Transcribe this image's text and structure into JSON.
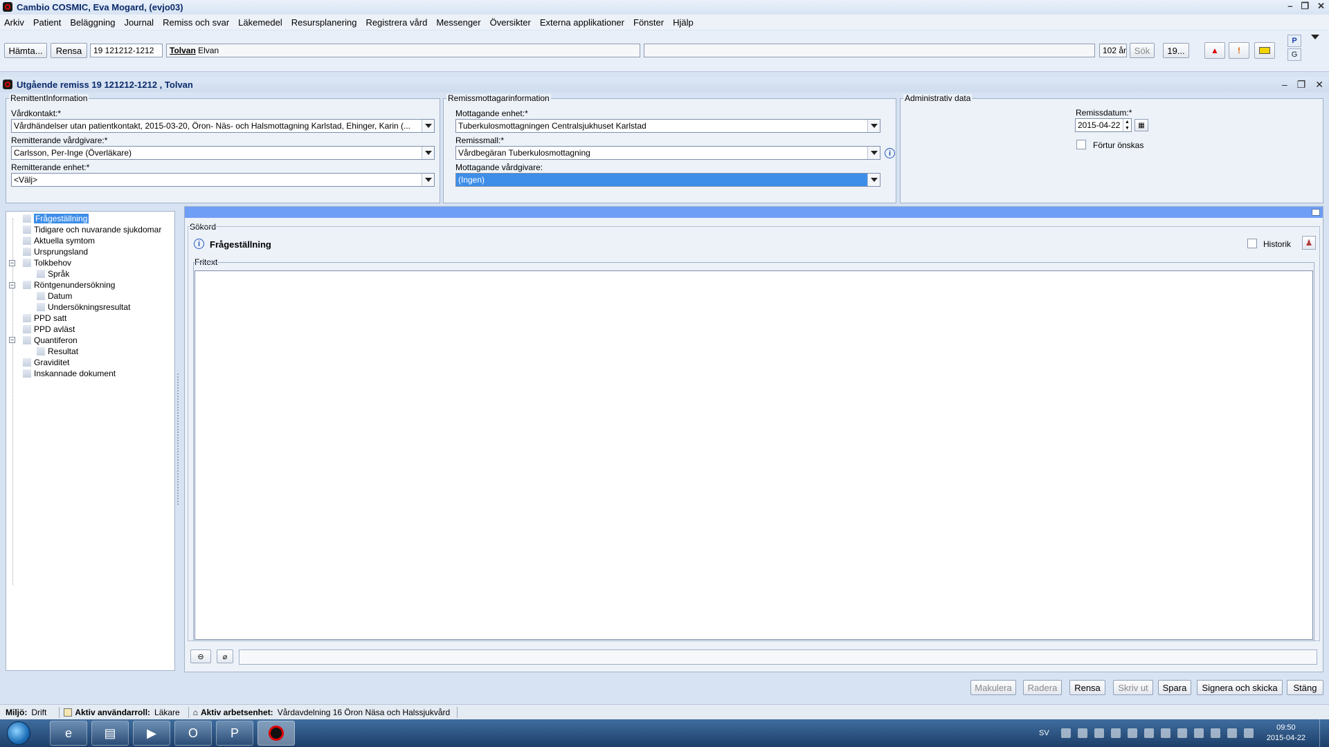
{
  "window": {
    "title": "Cambio COSMIC, Eva Mogard, (evjo03)"
  },
  "menu": [
    "Arkiv",
    "Patient",
    "Beläggning",
    "Journal",
    "Remiss och svar",
    "Läkemedel",
    "Resursplanering",
    "Registrera vård",
    "Messenger",
    "Översikter",
    "Externa applikationer",
    "Fönster",
    "Hjälp"
  ],
  "toolbar": {
    "fetch_label": "Hämta...",
    "clear_label": "Rensa",
    "personnummer": "19 121212-1212",
    "patient_lastname": "Tolvan",
    "patient_firstname": "Elvan",
    "age": "102 år",
    "search_label": "Sök",
    "year_label": "19...",
    "p_label": "P",
    "g_label": "G"
  },
  "document": {
    "title": "Utgående remiss 19 121212-1212 , Tolvan"
  },
  "remittent": {
    "title": "RemittentInformation",
    "vardkontakt_label": "Vårdkontakt:*",
    "vardkontakt_value": "Vårdhändelser utan patientkontakt, 2015-03-20, Öron- Näs- och Halsmottagning Karlstad, Ehinger, Karin (...",
    "vardgivare_label": "Remitterande vårdgivare:*",
    "vardgivare_value": "Carlsson, Per-Inge (Överläkare)",
    "enhet_label": "Remitterande enhet:*",
    "enhet_value": "<Välj>"
  },
  "mottagare": {
    "title": "Remissmottagarinformation",
    "enhet_label": "Mottagande enhet:*",
    "enhet_value": "Tuberkulosmottagningen Centralsjukhuset Karlstad",
    "mall_label": "Remissmall:*",
    "mall_value": "Vårdbegäran Tuberkulosmottagning",
    "vardgivare_label": "Mottagande vårdgivare:",
    "vardgivare_value": "(Ingen)"
  },
  "admin": {
    "title": "Administrativ data",
    "datum_label": "Remissdatum:*",
    "datum_value": "2015-04-22",
    "fortur_label": "Förtur önskas"
  },
  "tree": [
    {
      "label": "Frågeställning",
      "level": 0
    },
    {
      "label": "Tidigare och nuvarande sjukdomar",
      "level": 0
    },
    {
      "label": "Aktuella symtom",
      "level": 0
    },
    {
      "label": "Ursprungsland",
      "level": 0
    },
    {
      "label": "Tolkbehov",
      "level": 0
    },
    {
      "label": "Språk",
      "level": 1
    },
    {
      "label": "Röntgenundersökning",
      "level": 0
    },
    {
      "label": "Datum",
      "level": 1
    },
    {
      "label": "Undersökningsresultat",
      "level": 1
    },
    {
      "label": "PPD satt",
      "level": 0
    },
    {
      "label": "PPD avläst",
      "level": 0
    },
    {
      "label": "Quantiferon",
      "level": 0
    },
    {
      "label": "Resultat",
      "level": 1
    },
    {
      "label": "Graviditet",
      "level": 0
    },
    {
      "label": "Inskannade dokument",
      "level": 0
    }
  ],
  "content": {
    "sokord_label": "Sökord",
    "heading": "Frågeställning",
    "historik_label": "Historik",
    "fritext_label": "Fritext"
  },
  "actions": {
    "makulera": "Makulera",
    "radera": "Radera",
    "rensa": "Rensa",
    "skriv_ut": "Skriv ut",
    "spara": "Spara",
    "signera": "Signera och skicka",
    "stang": "Stäng"
  },
  "status": {
    "miljo_label": "Miljö:",
    "miljo_value": "Drift",
    "roll_label": "Aktiv användarroll:",
    "roll_value": "Läkare",
    "enhet_label": "Aktiv arbetsenhet:",
    "enhet_value": "Vårdavdelning 16 Öron Näsa och Halssjukvård"
  },
  "taskbar": {
    "lang": "SV",
    "time": "09:50",
    "date": "2015-04-22"
  }
}
